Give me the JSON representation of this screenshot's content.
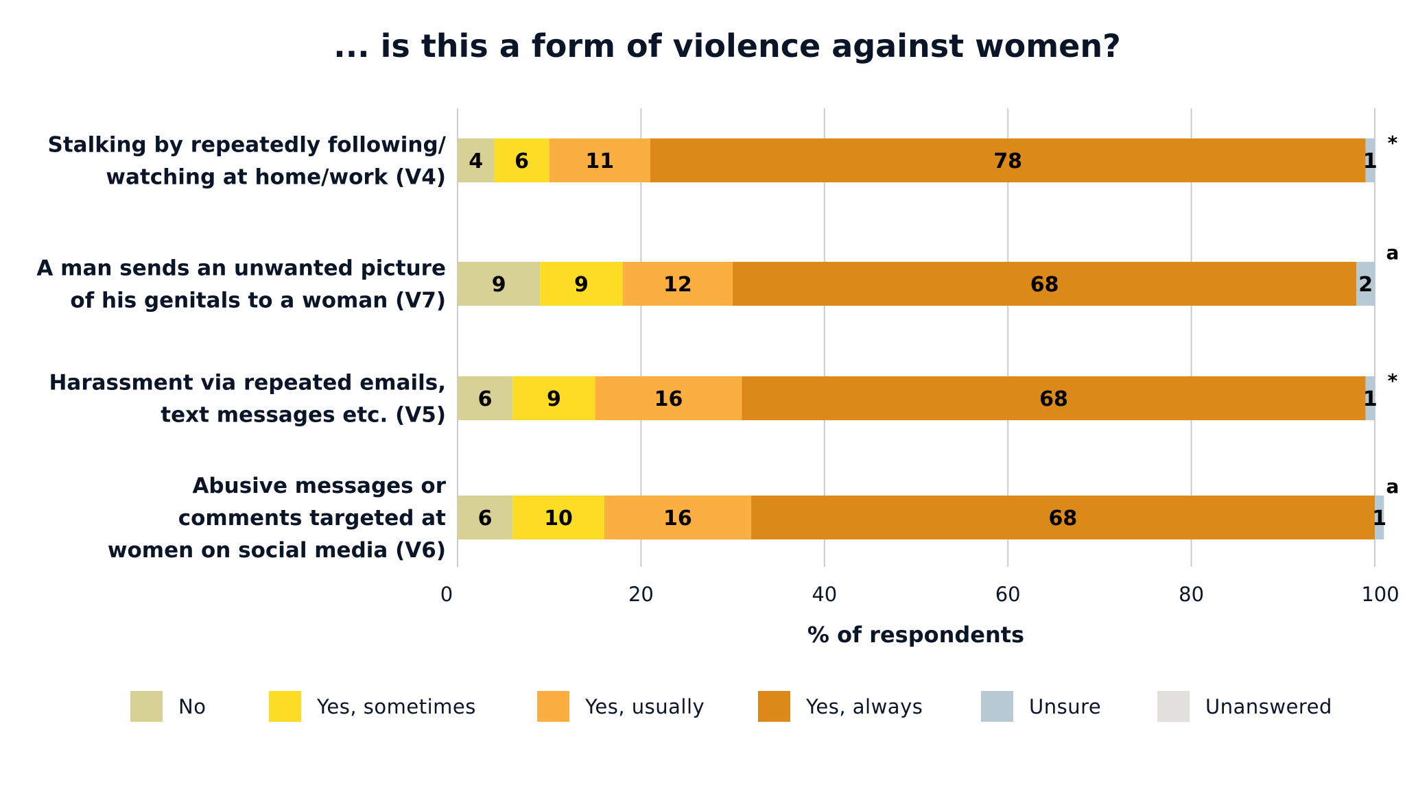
{
  "chart_data": {
    "type": "bar",
    "orientation": "horizontal",
    "stacked": true,
    "title": "... is this a form of violence against women?",
    "xlabel": "% of respondents",
    "ylabel": "",
    "xlim": [
      0,
      100
    ],
    "xticks": [
      0,
      20,
      40,
      60,
      80,
      100
    ],
    "grid": true,
    "legend_position": "bottom",
    "categories": [
      {
        "lines": [
          "Stalking by repeatedly following/",
          "watching at home/work (V4)"
        ],
        "note": "*"
      },
      {
        "lines": [
          "A man sends an unwanted picture",
          "of his genitals to a woman (V7)"
        ],
        "note": "a"
      },
      {
        "lines": [
          "Harassment via repeated emails,",
          "text messages etc. (V5)"
        ],
        "note": "*"
      },
      {
        "lines": [
          "Abusive messages or",
          "comments targeted at",
          "women on social media (V6)"
        ],
        "note": "a"
      }
    ],
    "series": [
      {
        "name": "No",
        "color": "#d8d196",
        "values": [
          4,
          9,
          6,
          6
        ]
      },
      {
        "name": "Yes, sometimes",
        "color": "#fddc26",
        "values": [
          6,
          9,
          9,
          10
        ]
      },
      {
        "name": "Yes, usually",
        "color": "#fbaf40",
        "values": [
          11,
          12,
          16,
          16
        ]
      },
      {
        "name": "Yes, always",
        "color": "#db8919",
        "values": [
          78,
          68,
          68,
          68
        ]
      },
      {
        "name": "Unsure",
        "color": "#b8c9d6",
        "values": [
          1,
          2,
          1,
          1
        ]
      },
      {
        "name": "Unanswered",
        "color": "#e2e0dd",
        "values": [
          0,
          0,
          0,
          0
        ]
      }
    ]
  }
}
